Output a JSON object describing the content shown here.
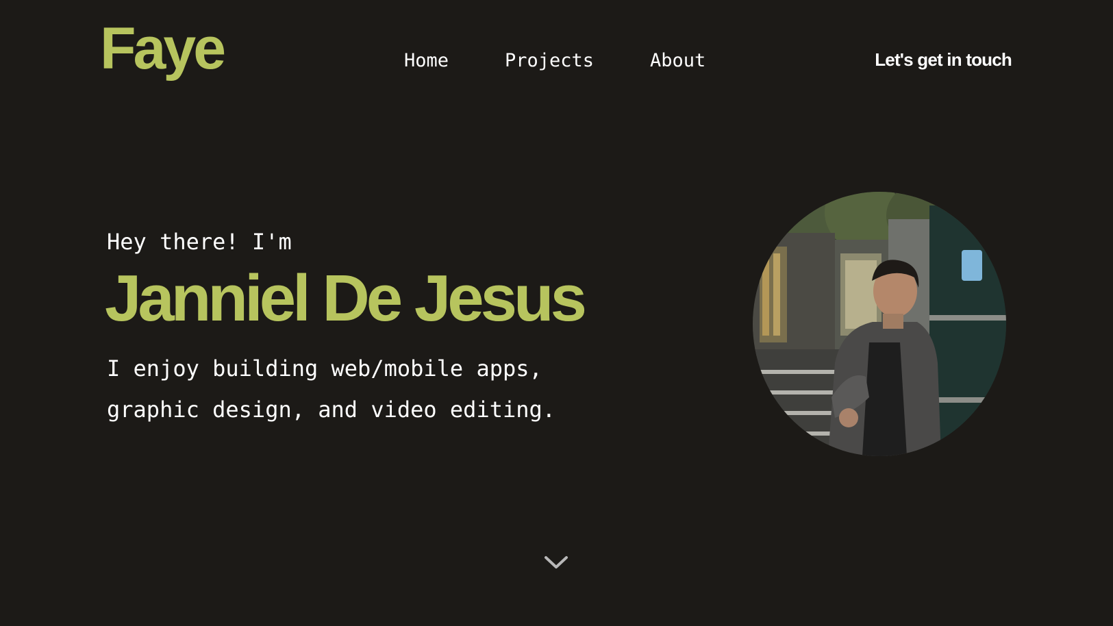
{
  "header": {
    "logo": "Faye",
    "nav": [
      {
        "label": "Home"
      },
      {
        "label": "Projects"
      },
      {
        "label": "About"
      }
    ],
    "cta_label": "Let's get in touch"
  },
  "hero": {
    "greeting": "Hey there! I'm",
    "name": "Janniel De Jesus",
    "tagline_line1": "I enjoy building web/mobile apps,",
    "tagline_line2": "graphic design, and video editing.",
    "avatar_icon": "profile-photo",
    "scroll_icon": "chevron-down-icon"
  },
  "colors": {
    "background": "#1c1a17",
    "accent": "#b7c45e",
    "text": "#ffffff"
  }
}
